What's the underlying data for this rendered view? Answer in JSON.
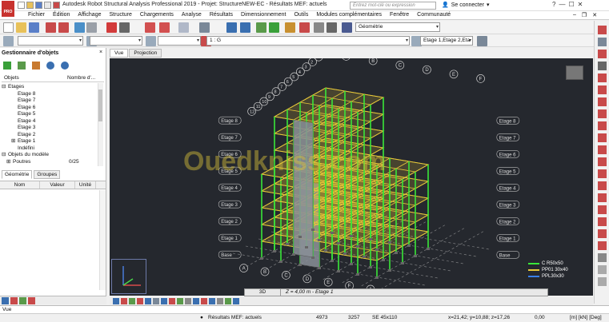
{
  "app": {
    "logo_text": "PRO",
    "title": "Autodesk Robot Structural Analysis Professional 2019 - Projet: StructureNEW-EC - Résultats MEF: actuels",
    "search_placeholder": "Entrez mot-clé ou expression",
    "login_label": "Se connecter",
    "colors": {
      "viewport_bg": "#25282e",
      "structure_green": "#39e639",
      "slab_yellow": "#e8c93a",
      "accent_red": "#c8322e"
    }
  },
  "menu": {
    "items": [
      "Fichier",
      "Édition",
      "Affichage",
      "Structure",
      "Chargements",
      "Analyse",
      "Résultats",
      "Dimensionnement",
      "Outils",
      "Modules complémentaires",
      "Fenêtre",
      "Communauté"
    ]
  },
  "toolbar": {
    "case_select": "1 : G",
    "view_select": "Géométrie",
    "story_select": "Etage 1,Etage 2,Eta",
    "story_arrow": "▾"
  },
  "object_manager": {
    "title": "Gestionnaire d'objets",
    "close_glyph": "×",
    "col_objects": "Objets",
    "col_count": "Nombre d'...",
    "tree": [
      {
        "label": "Etages",
        "indent": 0,
        "expander": "⊟",
        "count": ""
      },
      {
        "label": "Etage 8",
        "indent": 2,
        "expander": "",
        "count": ""
      },
      {
        "label": "Etage 7",
        "indent": 2,
        "expander": "",
        "count": ""
      },
      {
        "label": "Etage 6",
        "indent": 2,
        "expander": "",
        "count": ""
      },
      {
        "label": "Etage 5",
        "indent": 2,
        "expander": "",
        "count": ""
      },
      {
        "label": "Etage 4",
        "indent": 2,
        "expander": "",
        "count": ""
      },
      {
        "label": "Etage 3",
        "indent": 2,
        "expander": "",
        "count": ""
      },
      {
        "label": "Etage 2",
        "indent": 2,
        "expander": "",
        "count": ""
      },
      {
        "label": "Etage 1",
        "indent": 2,
        "expander": "⊞",
        "count": ""
      },
      {
        "label": "Indéfini",
        "indent": 2,
        "expander": "",
        "count": ""
      },
      {
        "label": "Objets du modèle",
        "indent": 0,
        "expander": "⊟",
        "count": ""
      },
      {
        "label": "Poutres",
        "indent": 1,
        "expander": "⊞",
        "count": "0/25"
      }
    ],
    "tabs": [
      "Géométrie",
      "Groupes"
    ],
    "props_columns": [
      "Nom",
      "Valeur",
      "Unité"
    ]
  },
  "view_tabs": [
    "Vue",
    "Projection"
  ],
  "viewport": {
    "mode": "3D",
    "level_text": "Z = 4,00 m - Etage 1",
    "grid_letters": [
      "A",
      "B",
      "C",
      "D",
      "E",
      "F"
    ],
    "grid_numbers": [
      "1",
      "2",
      "3",
      "4",
      "5",
      "6",
      "7",
      "8",
      "9",
      "10",
      "11",
      "12"
    ],
    "story_labels": [
      "Etage 8",
      "Etage 7",
      "Etage 6",
      "Etage 5",
      "Etage 4",
      "Etage 3",
      "Etage 2",
      "Etage 1",
      "Base"
    ],
    "watermark": "Ouedkniss.com",
    "legend": [
      {
        "label": "C R50x50",
        "color": "#39e639"
      },
      {
        "label": "PP01 30x40",
        "color": "#e8c93a"
      },
      {
        "label": "PPL30x30",
        "color": "#3a7fe8"
      }
    ]
  },
  "command_line": "Vue",
  "status": {
    "results": "Résultats MEF: actuels",
    "nodes": "4973",
    "bars": "3257",
    "section": "SE 45x110",
    "coords": "x=21,42; y=10,88; z=17,26",
    "angle": "0,00",
    "units": "[m] [kN] [Deg]"
  }
}
